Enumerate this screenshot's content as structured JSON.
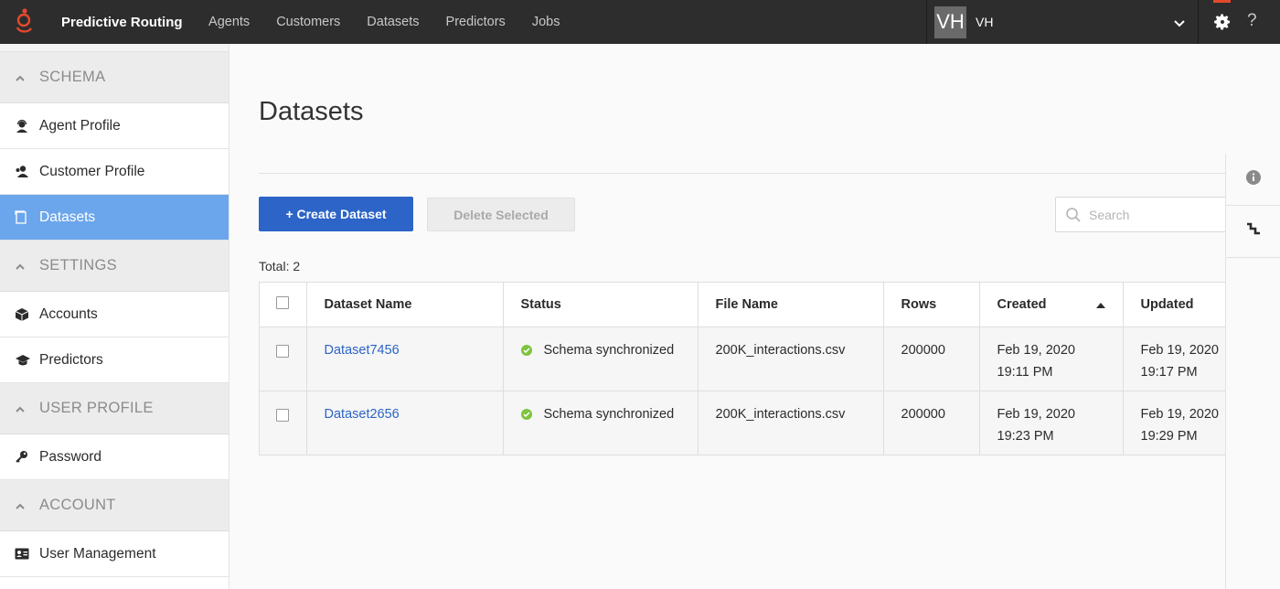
{
  "app": {
    "brand": "Predictive Routing",
    "nav": [
      "Agents",
      "Customers",
      "Datasets",
      "Predictors",
      "Jobs"
    ],
    "user_initials": "VH",
    "user_name": "VH",
    "help": "?"
  },
  "sidebar": {
    "sections": [
      {
        "title": "SCHEMA",
        "items": [
          {
            "label": "Agent Profile",
            "icon": "agent-icon"
          },
          {
            "label": "Customer Profile",
            "icon": "customer-icon"
          },
          {
            "label": "Datasets",
            "icon": "dataset-icon",
            "active": true
          }
        ]
      },
      {
        "title": "SETTINGS",
        "items": [
          {
            "label": "Accounts",
            "icon": "cube-icon"
          },
          {
            "label": "Predictors",
            "icon": "graduation-cap-icon"
          }
        ]
      },
      {
        "title": "USER PROFILE",
        "items": [
          {
            "label": "Password",
            "icon": "key-icon"
          }
        ]
      },
      {
        "title": "ACCOUNT",
        "items": [
          {
            "label": "User Management",
            "icon": "id-card-icon"
          }
        ]
      }
    ]
  },
  "main": {
    "title": "Datasets",
    "create_label": "+ Create Dataset",
    "delete_label": "Delete Selected",
    "search_placeholder": "Search",
    "total": "Total: 2",
    "columns": [
      "Dataset Name",
      "Status",
      "File Name",
      "Rows",
      "Created",
      "Updated"
    ],
    "rows": [
      {
        "name": "Dataset7456",
        "status": "Schema synchronized",
        "file": "200K_interactions.csv",
        "rows": "200000",
        "created_date": "Feb 19, 2020",
        "created_time": "19:11 PM",
        "updated_date": "Feb 19, 2020",
        "updated_time": "19:17 PM"
      },
      {
        "name": "Dataset2656",
        "status": "Schema synchronized",
        "file": "200K_interactions.csv",
        "rows": "200000",
        "created_date": "Feb 19, 2020",
        "created_time": "19:23 PM",
        "updated_date": "Feb 19, 2020",
        "updated_time": "19:29 PM"
      }
    ]
  },
  "colors": {
    "accent": "#2c64c7",
    "active_nav": "#6ba6ec",
    "topbar": "#2d2d2e",
    "status_ok": "#7ec440",
    "logo": "#e5492c"
  }
}
